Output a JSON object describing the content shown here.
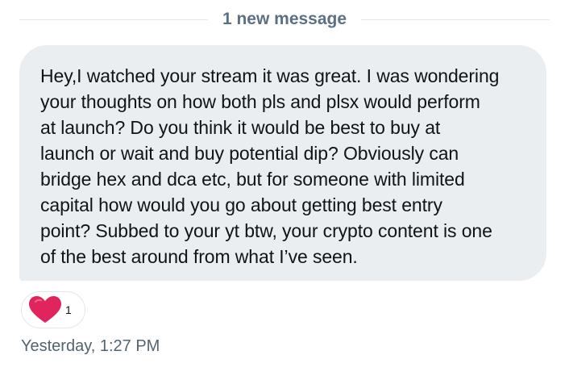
{
  "divider": {
    "label": "1 new message"
  },
  "message": {
    "lines": [
      "Hey,I watched your stream it was great. I was wondering",
      "your thoughts on how both pls and plsx would perform",
      "at launch? Do you think it would be best to buy at",
      "launch or wait and buy potential dip? Obviously can",
      "bridge hex and dca etc, but for someone with limited",
      "capital how would you go about getting best entry",
      "point? Subbed to your yt btw, your crypto content is one",
      "of the best around from what I’ve seen."
    ],
    "reaction": {
      "icon": "heart-icon",
      "count": "1",
      "color": "#e0245e"
    },
    "timestamp": "Yesterday, 1:27 PM"
  },
  "colors": {
    "bubble_bg": "#ebeef0",
    "text": "#0f1419",
    "muted": "#536471",
    "divider_line": "#e1e8ed"
  }
}
